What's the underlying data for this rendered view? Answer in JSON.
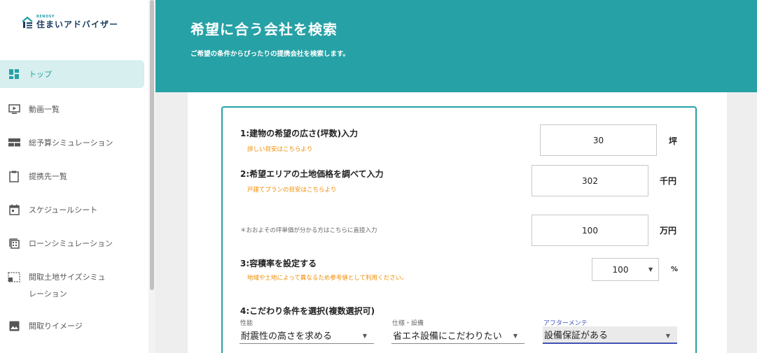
{
  "brand": {
    "small": "RENOSY",
    "name": "住まいアドバイザー"
  },
  "sidebar": {
    "items": [
      {
        "label": "トップ",
        "icon": "dashboard-icon"
      },
      {
        "label": "動画一覧",
        "icon": "video-icon"
      },
      {
        "label": "総予算シミュレーション",
        "icon": "table-icon"
      },
      {
        "label": "提携先一覧",
        "icon": "clipboard-icon"
      },
      {
        "label": "スケジュールシート",
        "icon": "calendar-icon"
      },
      {
        "label": "ローンシミュレーション",
        "icon": "calculator-icon"
      },
      {
        "label": "間取土地サイズシミュレーション",
        "icon": "floorplan-icon"
      },
      {
        "label": "間取りイメージ",
        "icon": "image-icon"
      }
    ]
  },
  "header": {
    "title": "希望に合う会社を検索",
    "subtitle": "ご希望の条件からぴったりの提携会社を検索します。"
  },
  "form": {
    "q1": {
      "title": "1:建物の希望の広さ(坪数)入力",
      "sub": "詳しい目安はこちらより",
      "value": "30",
      "unit": "坪"
    },
    "q2": {
      "title": "2:希望エリアの土地価格を調べて入力",
      "sub": "戸建てプランの目安はこちらより",
      "value": "302",
      "unit": "千円"
    },
    "q2b": {
      "note": "＊おおよその坪単価が分かる方はこちらに直接入力",
      "value": "100",
      "unit": "万円"
    },
    "q3": {
      "title": "3:容積率を設定する",
      "sub": "地域や土地によって異なるため参考値として利用ください。",
      "value": "100",
      "unit": "%"
    },
    "q4": {
      "title": "4:こだわり条件を選択(複数選択可)",
      "selects": [
        {
          "label": "性能",
          "value": "耐震性の高さを求める"
        },
        {
          "label": "仕様・設備",
          "value": "省エネ設備にこだわりたい"
        },
        {
          "label": "アフターメンテ",
          "value": "設備保証がある"
        }
      ]
    }
  },
  "colors": {
    "accent": "#26a1a6",
    "warning": "#f08c00",
    "focus": "#3f51b5"
  }
}
